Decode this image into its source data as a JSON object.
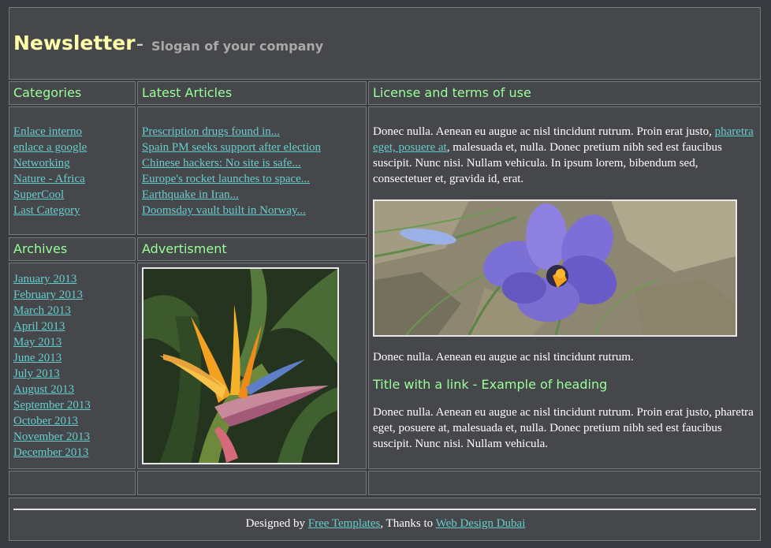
{
  "header": {
    "title": "Newsletter",
    "separator": "–",
    "slogan": "Slogan of your company"
  },
  "categories": {
    "title": "Categories",
    "items": [
      "Enlace interno",
      "enlace a google",
      "Networking",
      "Nature - Africa",
      "SuperCool",
      "Last Category"
    ]
  },
  "latest_articles": {
    "title": "Latest Articles",
    "items": [
      "Prescription drugs found in...",
      "Spain PM seeks support after election",
      "Chinese hackers: No site is safe...",
      "Europe's rocket launches to space...",
      "Earthquake in Iran...",
      "Doomsday vault built in Norway..."
    ]
  },
  "archives": {
    "title": "Archives",
    "items": [
      "January 2013",
      "February 2013",
      "March 2013",
      "April 2013",
      "May 2013",
      "June 2013",
      "July 2013",
      "August 2013",
      "September 2013",
      "October 2013",
      "November 2013",
      "December 2013"
    ]
  },
  "advertisment": {
    "title": "Advertisment"
  },
  "license": {
    "title": "License and terms of use",
    "p1_before": "Donec nulla. Aenean eu augue ac nisl tincidunt rutrum. Proin erat justo, ",
    "p1_link": "pharetra eget, posuere at",
    "p1_after": ", malesuada et, nulla. Donec pretium nibh sed est faucibus suscipit. Nunc nisi. Nullam vehicula. In ipsum lorem, bibendum sed, consectetuer et, gravida id, erat.",
    "p2": "Donec nulla. Aenean eu augue ac nisl tincidunt rutrum.",
    "heading": "Title with a link - Example of heading",
    "p3": "Donec nulla. Aenean eu augue ac nisl tincidunt rutrum. Proin erat justo, pharetra eget, posuere at, malesuada et, nulla. Donec pretium nibh sed est faucibus suscipit. Nunc nisi. Nullam vehicula."
  },
  "footer": {
    "designed_by": "Designed by ",
    "link1": "Free Templates",
    "thanks": ", Thanks to ",
    "link2": "Web Design Dubai"
  },
  "colors": {
    "background": "#3a3b40",
    "panel": "#46474b",
    "title_yellow": "#ffffaa",
    "section_green": "#99ff99",
    "link_teal": "#66cccc"
  }
}
